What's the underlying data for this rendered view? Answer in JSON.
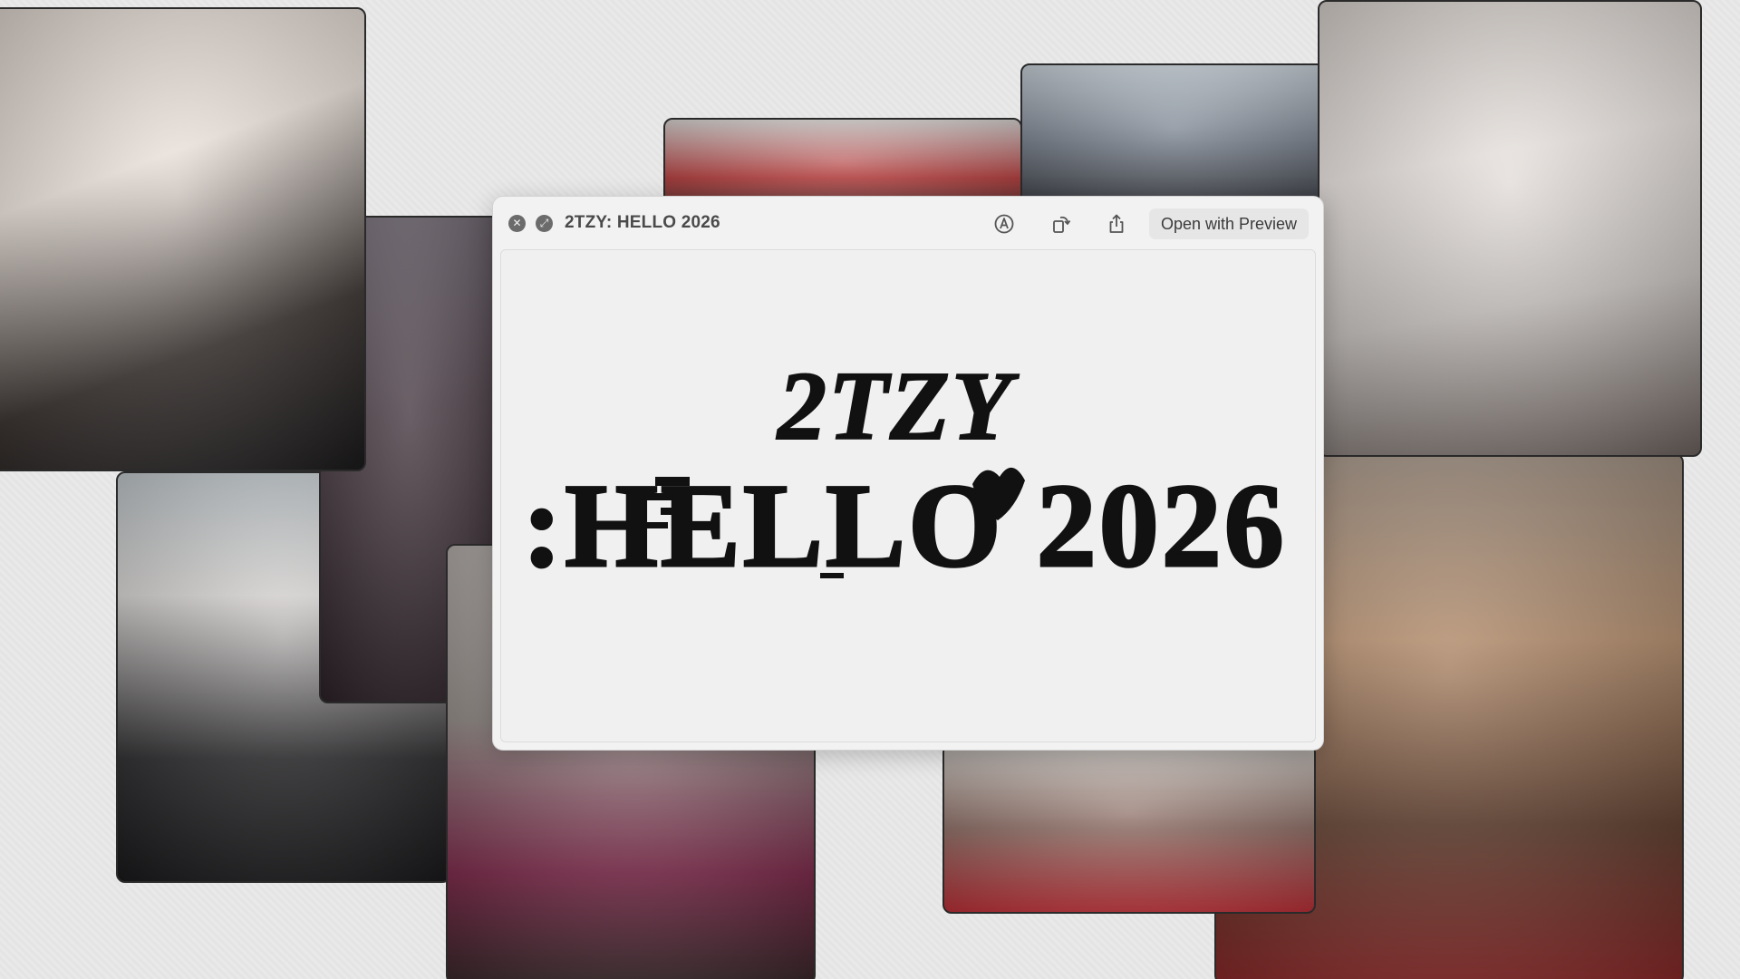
{
  "window": {
    "title": "2TZY: HELLO 2026",
    "open_button_label": "Open with Preview"
  },
  "artwork": {
    "line1": "2TZY",
    "line2": ":HELLO 2026"
  },
  "icons": {
    "close": "close-icon",
    "fullscreen": "fullscreen-icon",
    "markup": "markup-icon",
    "rotate": "rotate-icon",
    "share": "share-icon"
  },
  "colors": {
    "title_text": "#4a4a4a",
    "icon": "#555555",
    "button_bg": "#e6e6e6",
    "artwork_ink": "#111111"
  }
}
